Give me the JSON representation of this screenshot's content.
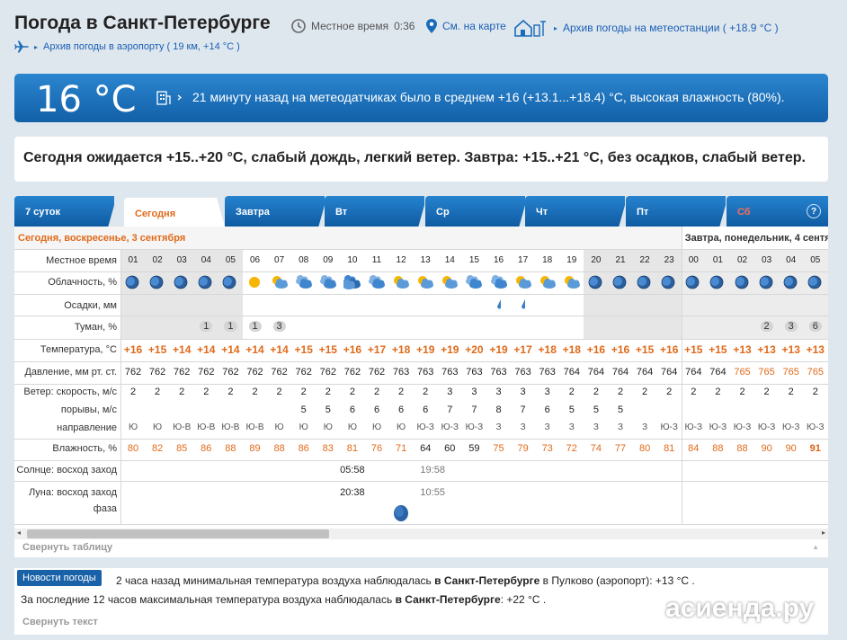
{
  "header": {
    "title": "Погода в Санкт-Петербурге",
    "local_time_label": "Местное время",
    "local_time": "0:36",
    "map_link": "См. на карте",
    "archive_station": "Архив погоды на метеостанции ( +18.9 °C )",
    "archive_airport": "Архив погоды в аэропорту ( 19 км, +14 °C )"
  },
  "now": {
    "temp": "16 °C",
    "text": "21 минуту назад на метеодатчиках было в среднем +16 (+13.1...+18.4) °C, высокая влажность (80%)."
  },
  "forecast_text": "Сегодня ожидается +15..+20 °C, слабый дождь, легкий ветер. Завтра: +15..+21 °C, без осадков, слабый ветер.",
  "tabs": [
    "7 суток",
    "Сегодня",
    "Завтра",
    "Вт",
    "Ср",
    "Чт",
    "Пт",
    "Сб"
  ],
  "help": "?",
  "today_label": "Сегодня, воскресенье, 3 сентября",
  "tomorrow_label": "Завтра, понедельник, 4 сентября",
  "row_labels": {
    "time": "Местное время",
    "cloud": "Облачность, %",
    "precip": "Осадки, мм",
    "fog": "Туман, %",
    "temp": "Температура, °C",
    "pressure": "Давление, мм рт. ст.",
    "wind": "Ветер: скорость, м/с",
    "gust": "порывы, м/с",
    "dir": "направление",
    "humidity": "Влажность, %",
    "sun": "Солнце: восход заход",
    "moon": "Луна: восход заход",
    "phase": "фаза"
  },
  "hours": [
    "01",
    "02",
    "03",
    "04",
    "05",
    "06",
    "07",
    "08",
    "09",
    "10",
    "11",
    "12",
    "13",
    "14",
    "15",
    "16",
    "17",
    "18",
    "19",
    "20",
    "21",
    "22",
    "23",
    "00",
    "01",
    "02",
    "03",
    "04",
    "05"
  ],
  "cloud_icons": [
    "moon",
    "moon",
    "moon",
    "moon",
    "moon",
    "sun",
    "suncloud",
    "clouds",
    "clouds",
    "heavycloud",
    "clouds",
    "suncloud",
    "suncloud",
    "suncloud",
    "clouds",
    "clouds",
    "suncloud",
    "suncloud",
    "suncloud",
    "moon",
    "moon",
    "moon",
    "moon",
    "moon",
    "moon",
    "moon",
    "moon",
    "moon",
    "moon"
  ],
  "precip": [
    "",
    "",
    "",
    "",
    "",
    "",
    "",
    "",
    "",
    "",
    "",
    "",
    "",
    "",
    "",
    "drop",
    "drop",
    "",
    "",
    "",
    "",
    "",
    "",
    "",
    "",
    "",
    "",
    "",
    ""
  ],
  "fog": [
    "",
    "",
    "",
    "1",
    "1",
    "1",
    "3",
    "",
    "",
    "",
    "",
    "",
    "",
    "",
    "",
    "",
    "",
    "",
    "",
    "",
    "",
    "",
    "",
    "",
    "",
    "",
    "2",
    "3",
    "6"
  ],
  "temps": [
    "+16",
    "+15",
    "+14",
    "+14",
    "+14",
    "+14",
    "+14",
    "+15",
    "+15",
    "+16",
    "+17",
    "+18",
    "+19",
    "+19",
    "+20",
    "+19",
    "+17",
    "+18",
    "+18",
    "+16",
    "+16",
    "+15",
    "+16",
    "+15",
    "+15",
    "+13",
    "+13",
    "+13",
    "+13"
  ],
  "pressure": [
    "762",
    "762",
    "762",
    "762",
    "762",
    "762",
    "762",
    "762",
    "762",
    "762",
    "762",
    "763",
    "763",
    "763",
    "763",
    "763",
    "763",
    "763",
    "764",
    "764",
    "764",
    "764",
    "764",
    "764",
    "764",
    "765",
    "765",
    "765",
    "765"
  ],
  "wind": [
    "2",
    "2",
    "2",
    "2",
    "2",
    "2",
    "2",
    "2",
    "2",
    "2",
    "2",
    "2",
    "2",
    "3",
    "3",
    "3",
    "3",
    "3",
    "2",
    "2",
    "2",
    "2",
    "2",
    "2",
    "2",
    "2",
    "2",
    "2",
    "2"
  ],
  "gust": [
    "",
    "",
    "",
    "",
    "",
    "",
    "",
    "5",
    "5",
    "6",
    "6",
    "6",
    "6",
    "7",
    "7",
    "8",
    "7",
    "6",
    "5",
    "5",
    "5",
    "",
    "",
    "",
    "",
    "",
    "",
    "",
    ""
  ],
  "dir": [
    "Ю",
    "Ю",
    "Ю-В",
    "Ю-В",
    "Ю-В",
    "Ю-В",
    "Ю",
    "Ю",
    "Ю",
    "Ю",
    "Ю",
    "Ю",
    "Ю-З",
    "Ю-З",
    "Ю-З",
    "З",
    "З",
    "З",
    "З",
    "З",
    "З",
    "З",
    "Ю-З",
    "Ю-З",
    "Ю-З",
    "Ю-З",
    "Ю-З",
    "Ю-З",
    "Ю-З"
  ],
  "humidity": [
    "80",
    "82",
    "85",
    "86",
    "88",
    "89",
    "88",
    "86",
    "83",
    "81",
    "76",
    "71",
    "64",
    "60",
    "59",
    "75",
    "79",
    "73",
    "72",
    "74",
    "77",
    "80",
    "81",
    "84",
    "88",
    "88",
    "90",
    "90",
    "91"
  ],
  "sun": {
    "rise": "05:58",
    "set": "19:58"
  },
  "moon": {
    "rise": "20:38",
    "set": "10:55"
  },
  "collapse_table": "Свернуть таблицу",
  "news": {
    "badge": "Новости погоды",
    "l1_pre": "2 часа назад минимальная температура воздуха наблюдалась",
    "l1_city": "в Санкт-Петербурге",
    "l1_post": "в Пулково (аэропорт): +13 °C .",
    "l2_pre": "За последние 12 часов максимальная температура воздуха наблюдалась",
    "l2_city": "в Санкт-Петербурге",
    "l2_post": ": +22 °C .",
    "collapse": "Свернуть текст"
  },
  "watermark": "асиенда.ру",
  "colors": {
    "tab_blue": "#1a6cba",
    "orange": "#e06a1a",
    "bar_blue": "#1868b4"
  }
}
